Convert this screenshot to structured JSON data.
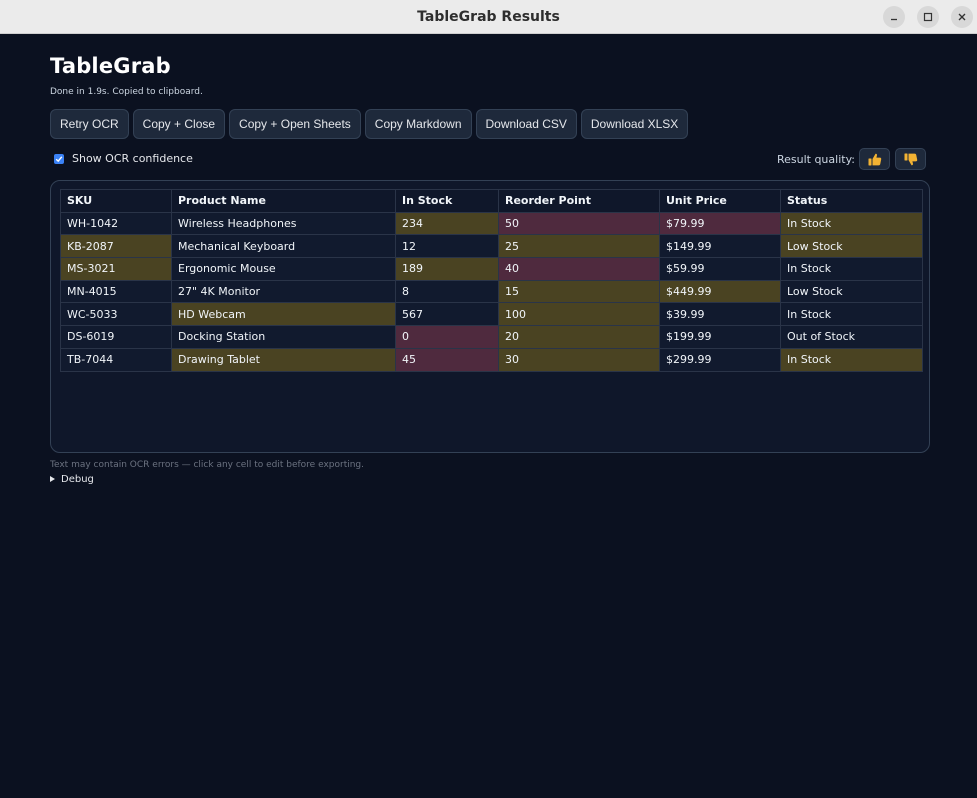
{
  "window": {
    "title": "TableGrab Results",
    "controls": [
      "minimize-icon",
      "maximize-icon",
      "close-icon"
    ]
  },
  "app": {
    "title": "TableGrab",
    "status": "Done in 1.9s. Copied to clipboard."
  },
  "toolbar": {
    "buttons": [
      {
        "label": "Retry OCR"
      },
      {
        "label": "Copy + Close"
      },
      {
        "label": "Copy + Open Sheets"
      },
      {
        "label": "Copy Markdown"
      },
      {
        "label": "Download CSV"
      },
      {
        "label": "Download XLSX"
      }
    ]
  },
  "options": {
    "show_confidence_label": "Show OCR confidence",
    "show_confidence_checked": true,
    "quality_label": "Result quality:",
    "thumbs_up_icon": "thumbs-up-icon",
    "thumbs_down_icon": "thumbs-down-icon"
  },
  "colors": {
    "background": "#0b1120",
    "panel": "#0f172a",
    "cell_default": "#111a2e",
    "confidence_medium": "#4a4322",
    "confidence_low": "#4f2a3e",
    "accent": "#3b82f6"
  },
  "table": {
    "headers": [
      "SKU",
      "Product Name",
      "In Stock",
      "Reorder Point",
      "Unit Price",
      "Status"
    ],
    "rows": [
      [
        "WH-1042",
        "Wireless Headphones",
        "234",
        "50",
        "$79.99",
        "In Stock"
      ],
      [
        "KB-2087",
        "Mechanical Keyboard",
        "12",
        "25",
        "$149.99",
        "Low Stock"
      ],
      [
        "MS-3021",
        "Ergonomic Mouse",
        "189",
        "40",
        "$59.99",
        "In Stock"
      ],
      [
        "MN-4015",
        "27\" 4K Monitor",
        "8",
        "15",
        "$449.99",
        "Low Stock"
      ],
      [
        "WC-5033",
        "HD Webcam",
        "567",
        "100",
        "$39.99",
        "In Stock"
      ],
      [
        "DS-6019",
        "Docking Station",
        "0",
        "20",
        "$199.99",
        "Out of Stock"
      ],
      [
        "TB-7044",
        "Drawing Tablet",
        "45",
        "30",
        "$299.99",
        "In Stock"
      ]
    ],
    "confidence": [
      [
        "high",
        "high",
        "medium",
        "low",
        "low",
        "medium"
      ],
      [
        "medium",
        "high",
        "high",
        "medium",
        "high",
        "medium"
      ],
      [
        "medium",
        "high",
        "medium",
        "low",
        "high",
        "high"
      ],
      [
        "high",
        "high",
        "high",
        "medium",
        "medium",
        "high"
      ],
      [
        "high",
        "medium",
        "high",
        "medium",
        "high",
        "high"
      ],
      [
        "high",
        "high",
        "low",
        "medium",
        "high",
        "high"
      ],
      [
        "high",
        "medium",
        "low",
        "medium",
        "high",
        "medium"
      ]
    ]
  },
  "footer": {
    "note": "Text may contain OCR errors — click any cell to edit before exporting.",
    "debug_label": "Debug"
  }
}
